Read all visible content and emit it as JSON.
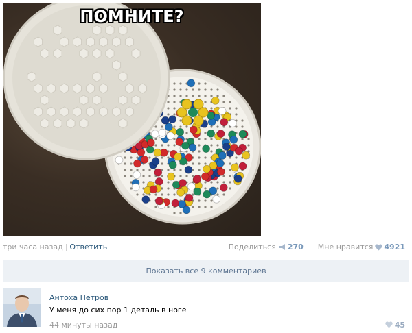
{
  "post": {
    "image_caption": "ПОМНИТЕ?",
    "time": "три часа назад",
    "separator": "|",
    "reply_label": "Ответить",
    "share_label": "Поделиться",
    "share_count": "270",
    "like_label": "Мне нравится",
    "like_count": "4921",
    "share_icon": "megaphone-icon",
    "like_icon": "heart-icon"
  },
  "show_all_comments_label": "Показать все 9 комментариев",
  "comment": {
    "author": "Антоха Петров",
    "text": "У меня до сих пор 1 деталь в ноге",
    "time": "44 минуты назад",
    "likes": "45",
    "avatar_icon": "user-avatar",
    "like_icon": "heart-icon"
  },
  "colors": {
    "link": "#2b587a",
    "muted": "#999999",
    "count": "#7b9abb",
    "bar_bg": "#edf1f5"
  }
}
